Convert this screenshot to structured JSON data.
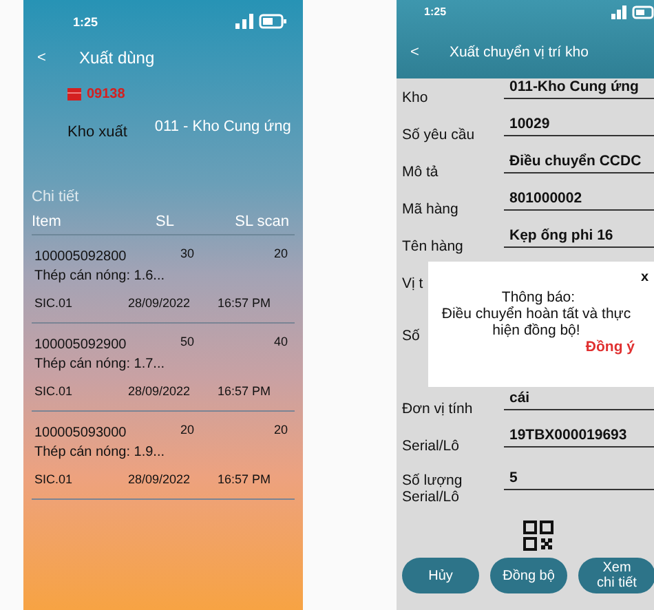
{
  "left_screen": {
    "status_bar": {
      "time": "1:25"
    },
    "header": {
      "back": "<",
      "title": "Xuất dùng"
    },
    "order": {
      "number": "09138"
    },
    "warehouse": {
      "label": "Kho xuất",
      "value": "011 - Kho Cung ứng"
    },
    "section_title": "Chi tiết",
    "table": {
      "columns": [
        "Item",
        "SL",
        "SL scan"
      ],
      "rows": [
        {
          "item": "100005092800",
          "sl": "30",
          "sl_scan": "20",
          "description": "Thép cán nóng: 1.6...",
          "code": "SIC.01",
          "date": "28/09/2022",
          "time": "16:57 PM"
        },
        {
          "item": "100005092900",
          "sl": "50",
          "sl_scan": "40",
          "description": "Thép cán nóng: 1.7...",
          "code": "SIC.01",
          "date": "28/09/2022",
          "time": "16:57 PM"
        },
        {
          "item": "100005093000",
          "sl": "20",
          "sl_scan": "20",
          "description": "Thép cán nóng: 1.9...",
          "code": "SIC.01",
          "date": "28/09/2022",
          "time": "16:57 PM"
        }
      ]
    }
  },
  "right_screen": {
    "status_bar": {
      "time": "1:25"
    },
    "header": {
      "back": "<",
      "title": "Xuất chuyển vị trí kho"
    },
    "fields": [
      {
        "label": "Kho",
        "value": "011-Kho Cung ứng"
      },
      {
        "label": "Số yêu cầu",
        "value": "10029"
      },
      {
        "label": "Mô tả",
        "value": "Điều chuyển CCDC"
      },
      {
        "label": "Mã hàng",
        "value": "801000002"
      },
      {
        "label": "Tên hàng",
        "value": "Kẹp ống phi 16"
      },
      {
        "label": "Vị t"
      },
      {
        "label": "Số"
      },
      {
        "label": "Đơn vị tính",
        "value": "cái"
      },
      {
        "label": "Serial/Lô",
        "value": "19TBX000019693"
      },
      {
        "label": "Số lượng Serial/Lô",
        "value": "5"
      }
    ],
    "dialog": {
      "close": "x",
      "title": "Thông báo:",
      "message": "Điều chuyển hoàn tất và thực hiện đồng bộ!",
      "confirm": "Đồng ý"
    },
    "buttons": [
      {
        "label": "Hủy"
      },
      {
        "label": "Đồng bộ"
      },
      {
        "label": "Xem chi tiết"
      }
    ]
  }
}
